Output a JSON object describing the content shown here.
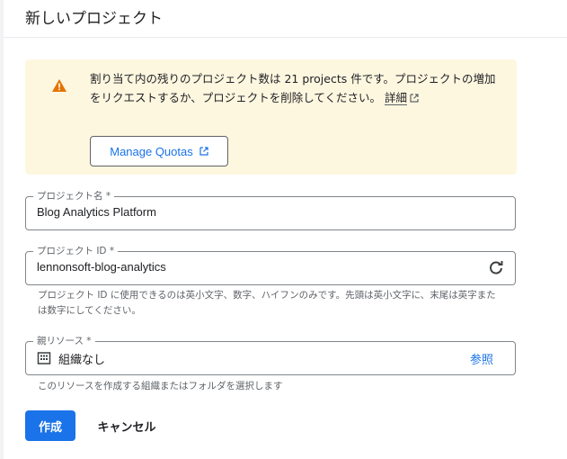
{
  "header": {
    "title": "新しいプロジェクト"
  },
  "warning": {
    "text": "割り当て内の残りのプロジェクト数は 21 projects 件です。プロジェクトの増加をリクエストするか、プロジェクトを削除してください。",
    "link_label": "詳細",
    "button_label": "Manage Quotas",
    "color": "#fef7e0",
    "icon_color": "#e37400"
  },
  "project_name": {
    "label": "プロジェクト名 *",
    "value": "Blog Analytics Platform"
  },
  "project_id": {
    "label": "プロジェクト ID *",
    "value": "lennonsoft-blog-analytics",
    "hint": "プロジェクト ID に使用できるのは英小文字、数字、ハイフンのみです。先頭は英小文字に、末尾は英字または数字にしてください。"
  },
  "parent": {
    "label": "親リソース *",
    "value": "組織なし",
    "browse_label": "参照",
    "hint": "このリソースを作成する組織またはフォルダを選択します"
  },
  "actions": {
    "create_label": "作成",
    "cancel_label": "キャンセル"
  },
  "colors": {
    "accent": "#1a73e8"
  }
}
